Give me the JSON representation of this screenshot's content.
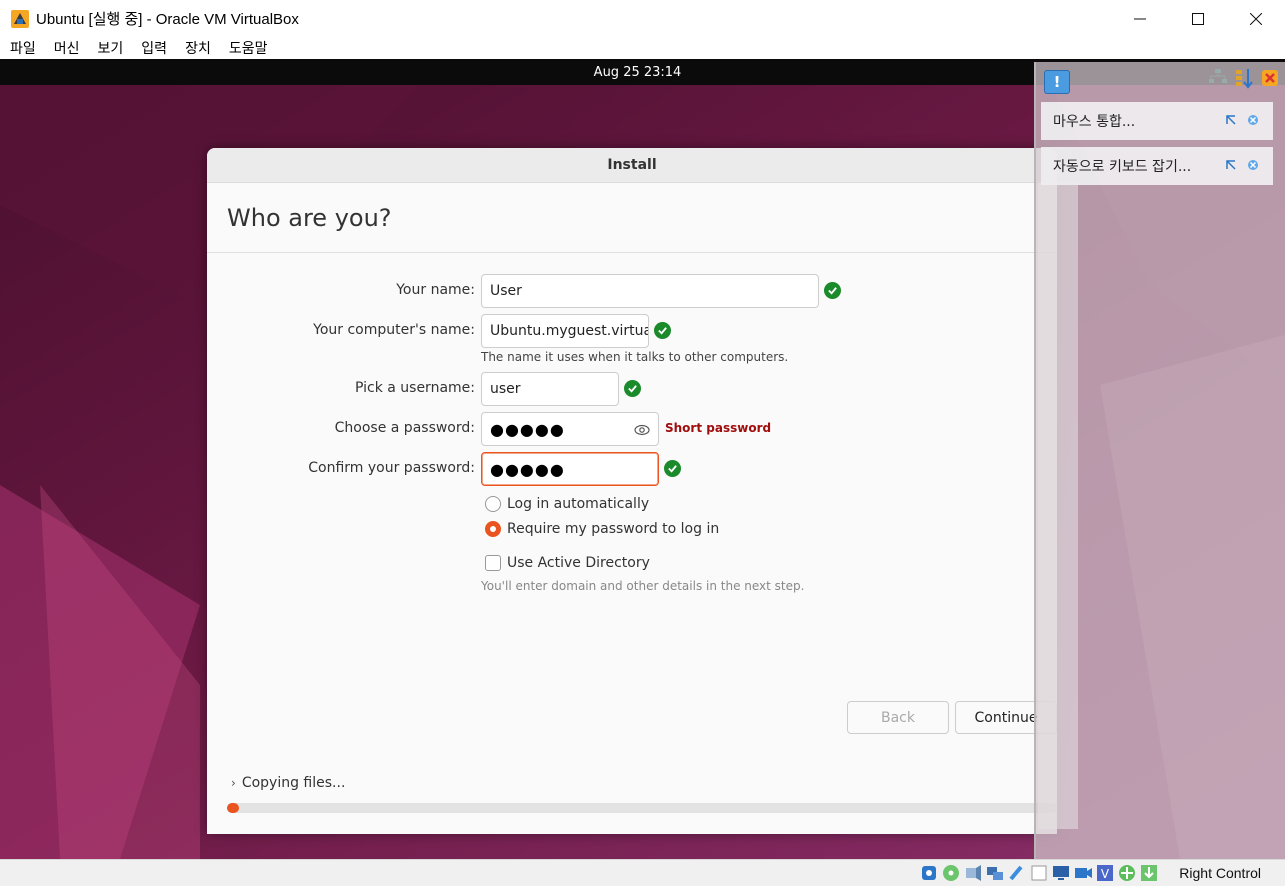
{
  "window": {
    "title": "Ubuntu [실행 중] - Oracle VM VirtualBox",
    "controls": [
      "minimize-icon",
      "maximize-icon",
      "close-icon"
    ]
  },
  "menu": {
    "items": [
      "파일",
      "머신",
      "보기",
      "입력",
      "장치",
      "도움말"
    ]
  },
  "guest": {
    "topbar_clock": "Aug 25  23:14",
    "dialog": {
      "title": "Install",
      "heading": "Who are you?",
      "fields": {
        "name_label": "Your name:",
        "name_value": "User",
        "computer_label": "Your computer's name:",
        "computer_value": "Ubuntu.myguest.virtua",
        "computer_hint": "The name it uses when it talks to other computers.",
        "username_label": "Pick a username:",
        "username_value": "user",
        "password_label": "Choose a password:",
        "password_value": "●●●●●",
        "password_strength": "Short password",
        "confirm_label": "Confirm your password:",
        "confirm_value": "●●●●●"
      },
      "options": {
        "auto_login": "Log in automatically",
        "require_password": "Require my password to log in",
        "selected": "require_password",
        "active_directory": "Use Active Directory",
        "active_directory_checked": false,
        "active_directory_hint": "You'll enter domain and other details in the next step."
      },
      "buttons": {
        "back": "Back",
        "continue": "Continue"
      },
      "progress": {
        "label": "Copying files...",
        "value_percent": 1.5
      }
    }
  },
  "vbox_notifications": {
    "items": [
      "마우스 통합...",
      "자동으로 키보드 잡기..."
    ]
  },
  "statusbar": {
    "host_key": "Right Control"
  },
  "colors": {
    "ubuntu_orange": "#e95420",
    "success_green": "#1a8a2b",
    "warning_red": "#a00d0d"
  }
}
